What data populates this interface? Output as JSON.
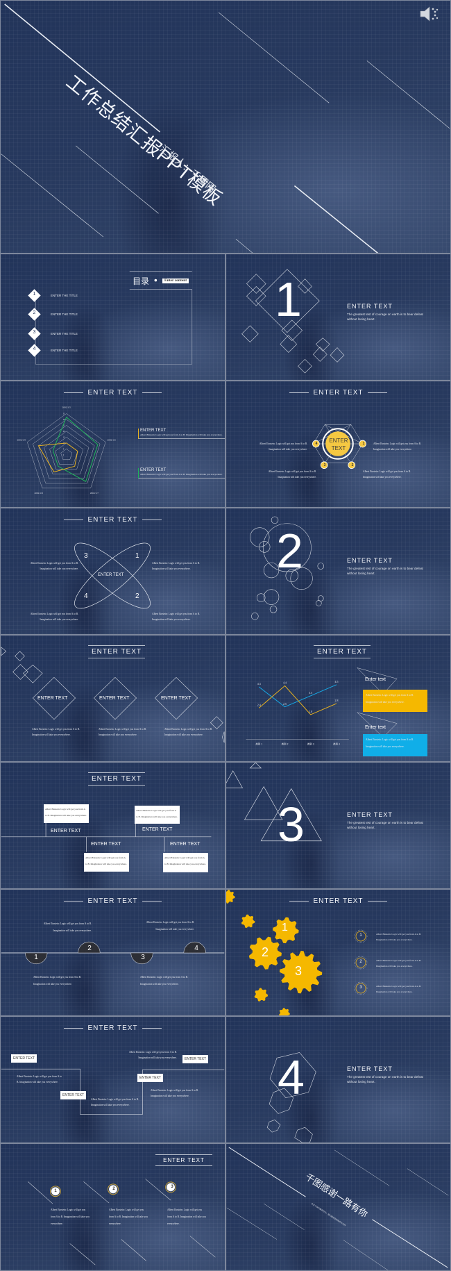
{
  "slides": {
    "cover": {
      "title": "工作总结汇报PPT模板",
      "subtitle": "汇报人：千图网",
      "audio_icon": "speaker-icon"
    },
    "contents": {
      "heading": "目录",
      "badge": "Enter content",
      "items": [
        {
          "num": "1",
          "label": "ENTER THE TITLE"
        },
        {
          "num": "2",
          "label": "ENTER THE TITLE"
        },
        {
          "num": "3",
          "label": "ENTER THE TITLE"
        },
        {
          "num": "4",
          "label": "ENTER THE TITLE"
        }
      ]
    },
    "section1": {
      "num": "1",
      "title": "ENTER  TEXT",
      "desc": "The greatest test of courage on earth is to bear defeat without losing heart."
    },
    "radar": {
      "header": "ENTER  TEXT",
      "blocks": [
        {
          "title": "ENTER  TEXT",
          "text": "Albert Einstein: Logic will get you from A to B. Imagination will take you everywhere.",
          "accent": "#e8b21f"
        },
        {
          "title": "ENTER  TEXT",
          "text": "Albert Einstein: Logic will get you from A to B. Imagination will take you everywhere.",
          "accent": "#1fb35a"
        }
      ]
    },
    "hexcircle": {
      "header": "ENTER  TEXT",
      "center": "ENTER TEXT",
      "nodes": [
        "1",
        "2",
        "3",
        "4"
      ],
      "texts": [
        "Albert Einstein: Logic will get you from A to B. Imagination will take you everywhere.",
        "Albert Einstein: Logic will get you from A to B. Imagination will take you everywhere.",
        "Albert Einstein: Logic will get you from A to B. Imagination will take you everywhere.",
        "Albert Einstein: Logic will get you from A to B. Imagination will take you everywhere."
      ],
      "accent": "#f5c842"
    },
    "ellipses": {
      "header": "ENTER  TEXT",
      "center": "ENTER TEXT",
      "nums": [
        "1",
        "2",
        "3",
        "4"
      ],
      "texts": [
        "Albert Einstein: Logic will get you from A to B. Imagination will take you everywhere.",
        "Albert Einstein: Logic will get you from A to B. Imagination will take you everywhere.",
        "Albert Einstein: Logic will get you from A to B. Imagination will take you everywhere.",
        "Albert Einstein: Logic will get you from A to B. Imagination will take you everywhere."
      ]
    },
    "section2": {
      "num": "2",
      "title": "ENTER  TEXT",
      "desc": "The greatest test of courage on earth is to bear defeat without losing heart."
    },
    "diamonds": {
      "header": "ENTER  TEXT",
      "items": [
        {
          "label": "ENTER  TEXT",
          "text": "Albert Einstein: Logic will get you from A to B. Imagination will take you everywhere."
        },
        {
          "label": "ENTER  TEXT",
          "text": "Albert Einstein: Logic will get you from A to B. Imagination will take you everywhere."
        },
        {
          "label": "ENTER  TEXT",
          "text": "Albert Einstein: Logic will get you from A to B. Imagination will take you everywhere."
        }
      ]
    },
    "linechart": {
      "header": "ENTER  TEXT",
      "cards": [
        {
          "title": "Enter text",
          "text": "Albert Einstein: Logic will get you from A to B. Imagination will take you everywhere.",
          "color": "#f5b800"
        },
        {
          "title": "Enter text",
          "text": "Albert Einstein: Logic will get you from A to B. Imagination will take you everywhere.",
          "color": "#10aee8"
        }
      ]
    },
    "timeline": {
      "header": "ENTER  TEXT",
      "items": [
        {
          "label": "ENTER  TEXT",
          "text": "Albert Einstein: Logic will get you from A to B. Imagination will take you everywhere."
        },
        {
          "label": "ENTER  TEXT",
          "text": "Albert Einstein: Logic will get you from A to B. Imagination will take you everywhere."
        },
        {
          "label": "ENTER  TEXT",
          "text": "Albert Einstein: Logic will get you from A to B. Imagination will take you everywhere."
        },
        {
          "label": "ENTER  TEXT",
          "text": "Albert Einstein: Logic will get you from A to B. Imagination will take you everywhere."
        }
      ]
    },
    "section3": {
      "num": "3",
      "title": "ENTER  TEXT",
      "desc": "The greatest test of courage on earth is to bear defeat without losing heart."
    },
    "semicircles": {
      "header": "ENTER  TEXT",
      "nums": [
        "1",
        "2",
        "3",
        "4"
      ],
      "texts": [
        "Albert Einstein: Logic will get you from A to B. Imagination will take you everywhere.",
        "Albert Einstein: Logic will get you from A to B. Imagination will take you everywhere.",
        "Albert Einstein: Logic will get you from A to B. Imagination will take you everywhere.",
        "Albert Einstein: Logic will get you from A to B. Imagination will take you everywhere."
      ]
    },
    "gears": {
      "header": "ENTER  TEXT",
      "gear_nums": [
        "1",
        "2",
        "3"
      ],
      "list": [
        {
          "num": "1",
          "text": "Albert Einstein: Logic will get you from A to B. Imagination will take you everywhere."
        },
        {
          "num": "2",
          "text": "Albert Einstein: Logic will get you from A to B. Imagination will take you everywhere."
        },
        {
          "num": "3",
          "text": "Albert Einstein: Logic will get you from A to B. Imagination will take you everywhere."
        }
      ],
      "accent": "#f5b800"
    },
    "steps": {
      "header": "ENTER  TEXT",
      "tags": [
        "ENTER TEXT",
        "ENTER TEXT",
        "ENTER TEXT",
        "ENTER TEXT"
      ],
      "texts": [
        "Albert Einstein: Logic will get you from A to B. Imagination will take you everywhere.",
        "Albert Einstein: Logic will get you from A to B. Imagination will take you everywhere.",
        "Albert Einstein: Logic will get you from A to B. Imagination will take you everywhere.",
        "Albert Einstein: Logic will get you from A to B. Imagination will take you everywhere."
      ]
    },
    "section4": {
      "num": "4",
      "title": "ENTER  TEXT",
      "desc": "The greatest test of courage on earth is to bear defeat without losing heart."
    },
    "three": {
      "header": "ENTER  TEXT",
      "items": [
        {
          "num": "1",
          "text": "Albert Einstein: Logic will get you from A to B. Imagination will take you everywhere."
        },
        {
          "num": "2",
          "text": "Albert Einstein: Logic will get you from A to B. Imagination will take you everywhere."
        },
        {
          "num": "3",
          "text": "Albert Einstein: Logic will get you from A to B. Imagination will take you everywhere."
        }
      ]
    },
    "closing": {
      "title": "千图感谢一路有你",
      "subtitle": "在这个快节奏的时代，我们感谢您的陪伴与支持"
    }
  },
  "chart_data": [
    {
      "type": "radar",
      "title": "",
      "axes": [
        "2002/1/5",
        "2002/1/6",
        "2002/1/7",
        "2002/1/8",
        "2002/1/9"
      ],
      "ticks": [
        0,
        5,
        10,
        15,
        20,
        25,
        30,
        35
      ],
      "range": [
        0,
        35
      ],
      "series": [
        {
          "name": "series-green",
          "color": "#1fb35a",
          "values": [
            32,
            28,
            28,
            12,
            12
          ]
        },
        {
          "name": "series-yellow",
          "color": "#e8b21f",
          "values": [
            10,
            10,
            12,
            18,
            25
          ]
        }
      ]
    },
    {
      "type": "line",
      "categories": [
        "类别 1",
        "类别 2",
        "类别 3",
        "类别 4"
      ],
      "series": [
        {
          "name": "series-blue",
          "color": "#16a9e6",
          "values": [
            4.3,
            2.5,
            3.5,
            4.5
          ]
        },
        {
          "name": "series-yellow",
          "color": "#e8b21f",
          "values": [
            2.4,
            4.4,
            1.8,
            2.8
          ]
        }
      ],
      "ylim": [
        1.5,
        4.6
      ],
      "grid": false
    }
  ]
}
